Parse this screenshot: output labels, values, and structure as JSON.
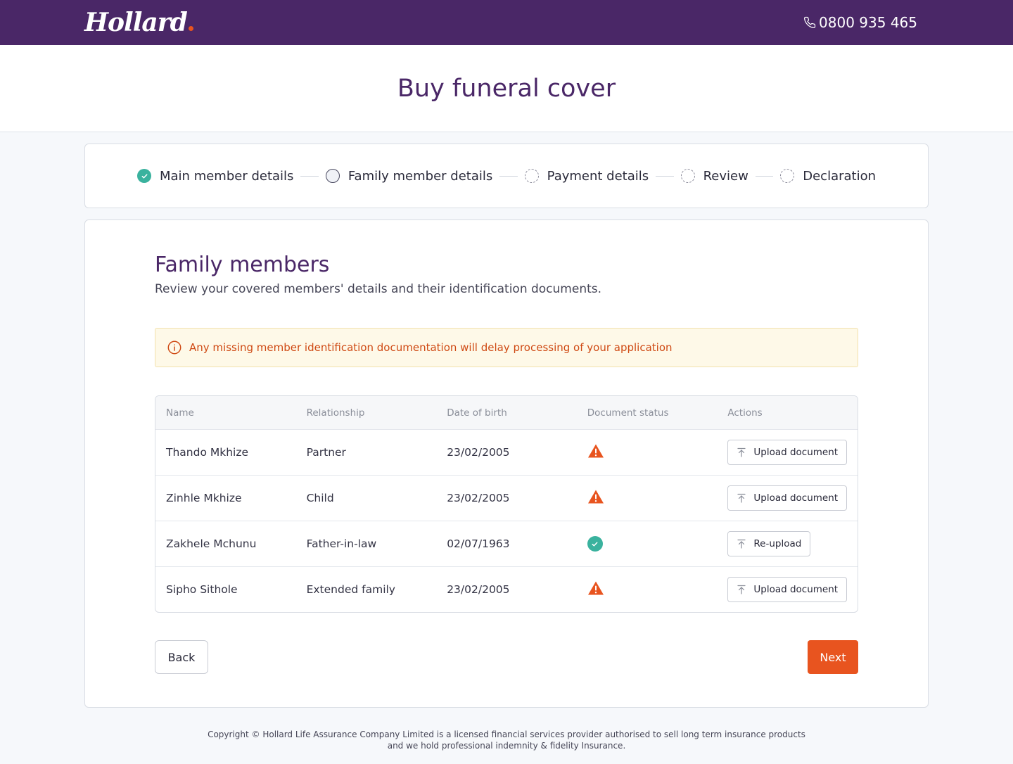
{
  "header": {
    "logo_text": "Hollard",
    "phone": "0800 935 465",
    "brand_color": "#4a2767",
    "accent_color": "#e8541f"
  },
  "page": {
    "title": "Buy funeral cover"
  },
  "stepper": {
    "steps": [
      {
        "label": "Main member details",
        "status": "done"
      },
      {
        "label": "Family member details",
        "status": "current"
      },
      {
        "label": "Payment details",
        "status": "todo"
      },
      {
        "label": "Review",
        "status": "todo"
      },
      {
        "label": "Declaration",
        "status": "todo"
      }
    ]
  },
  "section": {
    "title": "Family members",
    "subtitle": "Review your covered members' details and their identification documents."
  },
  "alert": {
    "icon": "info-icon",
    "text": "Any missing member identification documentation will delay processing of your application"
  },
  "table": {
    "columns": [
      "Name",
      "Relationship",
      "Date of birth",
      "Document status",
      "Actions"
    ],
    "rows": [
      {
        "name": "Thando Mkhize",
        "relationship": "Partner",
        "dob": "23/02/2005",
        "status": "missing",
        "action": "Upload document"
      },
      {
        "name": "Zinhle Mkhize",
        "relationship": "Child",
        "dob": "23/02/2005",
        "status": "missing",
        "action": "Upload document"
      },
      {
        "name": "Zakhele Mchunu",
        "relationship": "Father-in-law",
        "dob": "02/07/1963",
        "status": "uploaded",
        "action": "Re-upload"
      },
      {
        "name": "Sipho Sithole",
        "relationship": "Extended family",
        "dob": "23/02/2005",
        "status": "missing",
        "action": "Upload document"
      }
    ]
  },
  "nav": {
    "back_label": "Back",
    "next_label": "Next"
  },
  "footer": {
    "line1": "Copyright © Hollard Life Assurance Company Limited is a licensed financial services provider authorised to sell long term insurance products",
    "line2": "and we hold professional indemnity & fidelity Insurance."
  }
}
